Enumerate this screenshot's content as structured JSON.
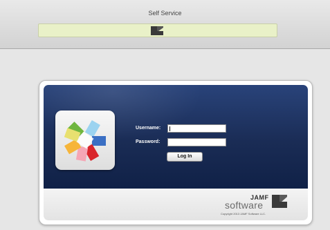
{
  "window": {
    "title": "Self Service"
  },
  "login": {
    "username_label": "Username:",
    "password_label": "Password:",
    "username_value": "",
    "password_value": "",
    "login_button": "Log In"
  },
  "branding": {
    "brand_top": "JAMF",
    "brand_main": "software",
    "copyright": "Copyright 2013 JAMF Software LLC.",
    "logo_icon": "casper-suite-logo-icon",
    "brand_icon": "jamf-mark-icon"
  },
  "colors": {
    "panel_top": "#29437a",
    "panel_bottom": "#102147",
    "url_bar": "#e9f1c8"
  }
}
